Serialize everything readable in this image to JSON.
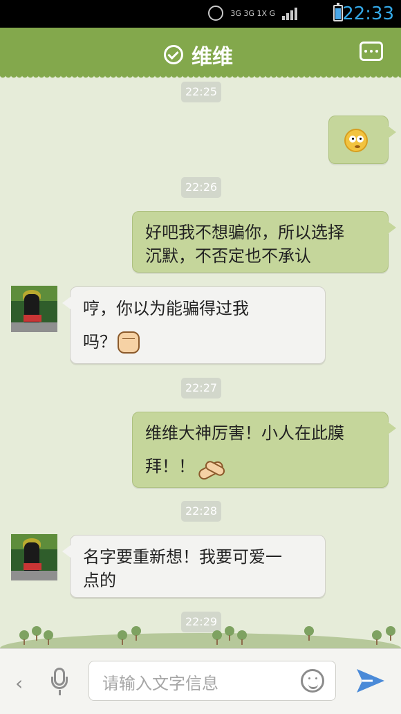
{
  "status_bar": {
    "time": "22:33",
    "network": "3G 3G 1X G",
    "battery_level": 70,
    "colors": {
      "clock": "#34a9e8",
      "background": "#000000"
    }
  },
  "header": {
    "title": "维维",
    "verified_icon": "check-circle-icon",
    "more_icon": "more-icon",
    "color": "#83a84c"
  },
  "messages": [
    {
      "time": "22:25"
    },
    {
      "side": "outgoing",
      "type": "emoji",
      "icon": "rolling-eyes-face-icon"
    },
    {
      "time": "22:26"
    },
    {
      "side": "outgoing",
      "line1": "好吧我不想骗你，所以选择",
      "line2": "沉默，不否定也不承认"
    },
    {
      "side": "incoming",
      "line1": "哼，你以为能骗得过我",
      "line2": "吗？",
      "icon": "fist-icon"
    },
    {
      "time": "22:27"
    },
    {
      "side": "outgoing",
      "line1": "维维大神厉害！小人在此膜",
      "line2": "拜！！",
      "icon": "praying-hands-icon"
    },
    {
      "time": "22:28"
    },
    {
      "side": "incoming",
      "line1": "名字要重新想！我要可爱一",
      "line2": "点的"
    },
    {
      "time": "22:29"
    }
  ],
  "input_bar": {
    "placeholder": "请输入文字信息",
    "back_symbol": "‹",
    "icons": [
      "back-icon",
      "microphone-icon",
      "emoji-icon",
      "send-icon"
    ],
    "send_color": "#4a8ad8"
  },
  "colors": {
    "background": "#e6ecd9",
    "outgoing_bubble": "#c5d69b",
    "incoming_bubble": "#f3f3f1",
    "timestamp": "#d2d7cb"
  }
}
